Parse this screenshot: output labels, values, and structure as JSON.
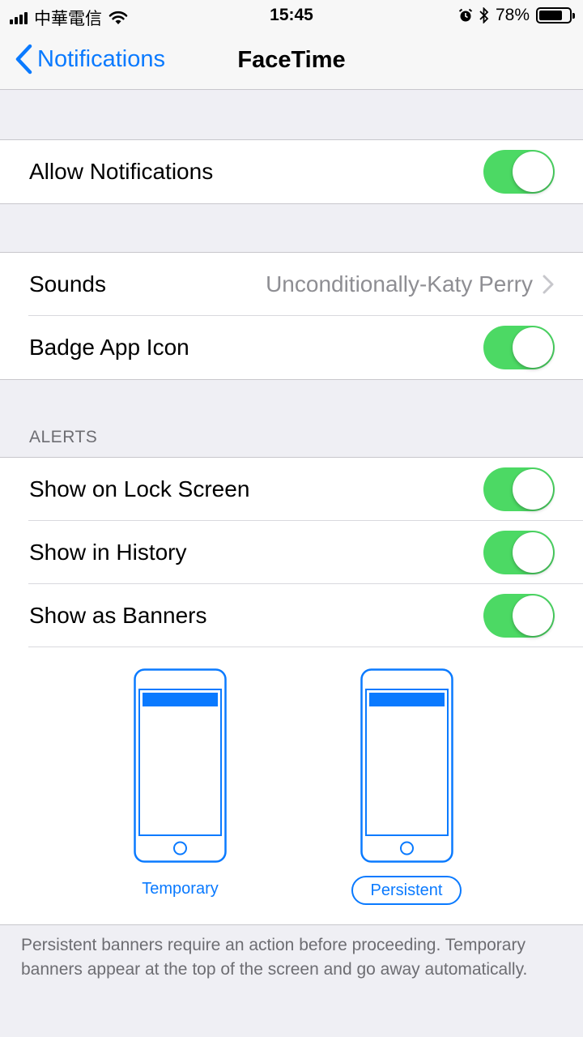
{
  "status_bar": {
    "carrier": "中華電信",
    "time": "15:45",
    "battery_percent": "78%",
    "battery_level": 0.78,
    "icons": [
      "signal-icon",
      "wifi-icon",
      "alarm-icon",
      "bluetooth-icon",
      "battery-icon"
    ]
  },
  "nav": {
    "back_label": "Notifications",
    "title": "FaceTime"
  },
  "group1": {
    "allow_notifications_label": "Allow Notifications",
    "allow_notifications_on": true
  },
  "group2": {
    "sounds_label": "Sounds",
    "sounds_value": "Unconditionally-Katy Perry",
    "badge_label": "Badge App Icon",
    "badge_on": true
  },
  "alerts": {
    "header": "ALERTS",
    "lock_screen_label": "Show on Lock Screen",
    "lock_screen_on": true,
    "history_label": "Show in History",
    "history_on": true,
    "banners_label": "Show as Banners",
    "banners_on": true,
    "banner_styles": {
      "temporary_label": "Temporary",
      "persistent_label": "Persistent",
      "selected": "Persistent"
    }
  },
  "footer": {
    "text": "Persistent banners require an action before proceeding. Temporary banners appear at the top of the screen and go away automatically."
  },
  "colors": {
    "accent": "#0a7aff",
    "toggle_on": "#4cd964",
    "background": "#efeff4",
    "secondary_text": "#8e8e93"
  }
}
